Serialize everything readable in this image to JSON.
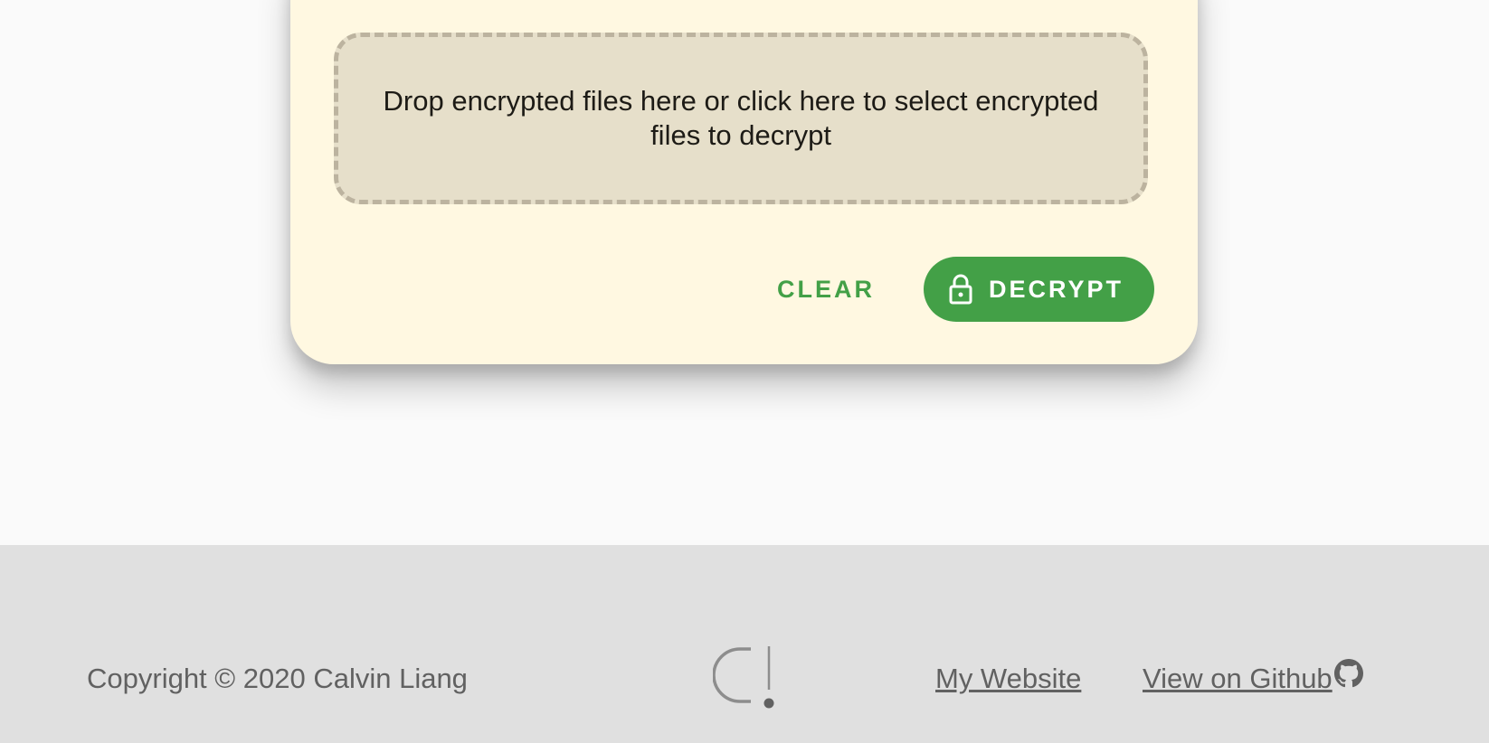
{
  "dropzone": {
    "text": "Drop encrypted files here or click here to select encrypted files to decrypt"
  },
  "actions": {
    "clear_label": "CLEAR",
    "decrypt_label": "DECRYPT",
    "decrypt_icon": "lock-icon"
  },
  "footer": {
    "copyright": "Copyright © 2020 Calvin Liang",
    "logo_icon": "ci-logo-icon",
    "website_label": "My Website",
    "github_label": "View on Github ",
    "github_icon": "github-icon"
  },
  "colors": {
    "accent": "#43a047",
    "card_background": "#fff8e1",
    "dropzone_background": "#e6dfca",
    "footer_background": "#e0e0e0",
    "footer_text": "#616161"
  }
}
